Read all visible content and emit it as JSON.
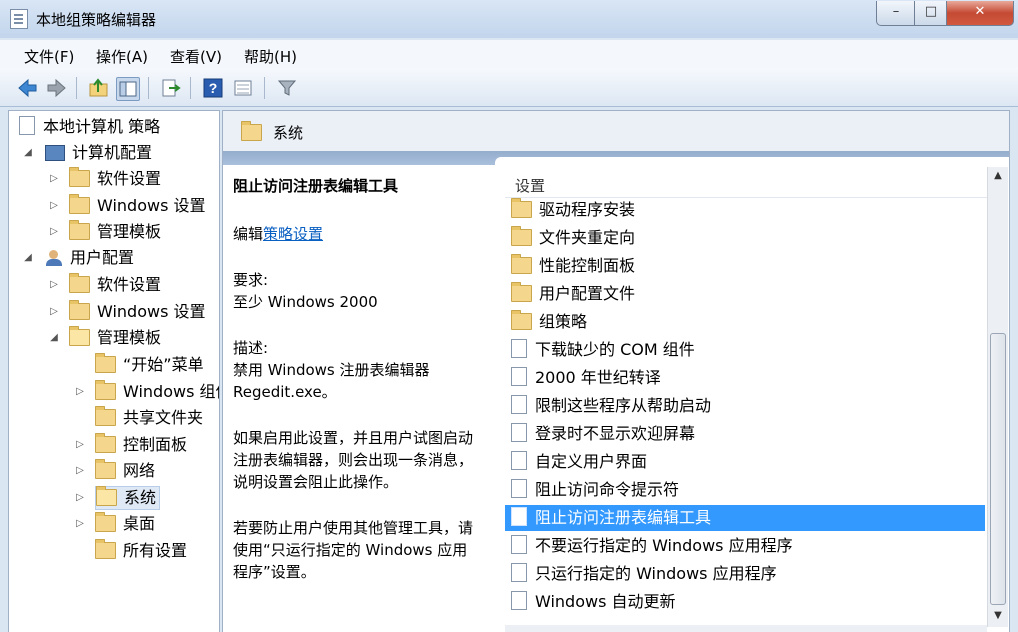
{
  "window": {
    "title": "本地组策略编辑器"
  },
  "window_controls": {
    "minimize": "–",
    "maximize": "□",
    "close": "✕"
  },
  "menu": [
    "文件(F)",
    "操作(A)",
    "查看(V)",
    "帮助(H)"
  ],
  "toolbar_icons": [
    "back-arrow-icon",
    "forward-arrow-icon",
    "up-folder-icon",
    "show-hide-tree-icon",
    "export-list-icon",
    "help-icon",
    "view-icon",
    "filter-icon"
  ],
  "tree": {
    "root": "本地计算机 策略",
    "computer": {
      "label": "计算机配置",
      "children": [
        "软件设置",
        "Windows 设置",
        "管理模板"
      ]
    },
    "user": {
      "label": "用户配置",
      "children": [
        "软件设置",
        "Windows 设置",
        "管理模板"
      ],
      "admin_children": [
        "“开始”菜单",
        "Windows 组件",
        "共享文件夹",
        "控制面板",
        "网络",
        "系统",
        "桌面",
        "所有设置"
      ]
    }
  },
  "header": {
    "title": "系统"
  },
  "description": {
    "title": "阻止访问注册表编辑工具",
    "edit_prefix": "编辑",
    "edit_link": "策略设置",
    "requirements_label": "要求:",
    "requirements_value": "至少 Windows 2000",
    "desc_label": "描述:",
    "desc_lines": [
      "禁用 Windows 注册表编辑器",
      "Regedit.exe。"
    ],
    "para2_lines": [
      "如果启用此设置，并且用户试图启动",
      "注册表编辑器，则会出现一条消息，",
      "说明设置会阻止此操作。"
    ],
    "para3_lines": [
      "若要防止用户使用其他管理工具，请",
      "使用“只运行指定的 Windows 应用",
      "程序”设置。"
    ]
  },
  "list": {
    "column_header": "设置",
    "folders": [
      "驱动程序安装",
      "文件夹重定向",
      "性能控制面板",
      "用户配置文件",
      "组策略"
    ],
    "settings": [
      "下载缺少的 COM 组件",
      "2000 年世纪转译",
      "限制这些程序从帮助启动",
      "登录时不显示欢迎屏幕",
      "自定义用户界面",
      "阻止访问命令提示符",
      "阻止访问注册表编辑工具",
      "不要运行指定的 Windows 应用程序",
      "只运行指定的 Windows 应用程序",
      "Windows 自动更新"
    ],
    "selected": "阻止访问注册表编辑工具"
  }
}
